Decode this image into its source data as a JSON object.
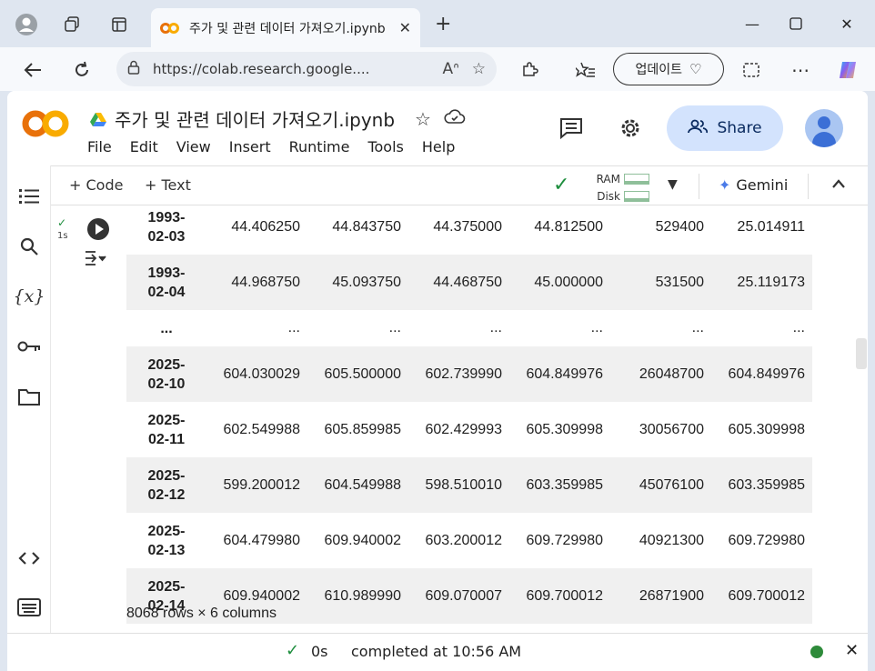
{
  "browser": {
    "tab_title": "주가 및 관련 데이터 가져오기.ipynb",
    "url": "https://colab.research.google....",
    "update_label": "업데이트"
  },
  "notebook": {
    "title": "주가 및 관련 데이터 가져오기.ipynb",
    "menu": [
      "File",
      "Edit",
      "View",
      "Insert",
      "Runtime",
      "Tools",
      "Help"
    ],
    "share_label": "Share"
  },
  "toolbar": {
    "code_label": "+ Code",
    "text_label": "+ Text",
    "ram_label": "RAM",
    "disk_label": "Disk",
    "gemini_label": "Gemini"
  },
  "cell": {
    "exec_time": "1s"
  },
  "dataframe": {
    "rows": [
      {
        "index": [
          "1993-",
          "02-03"
        ],
        "values": [
          "44.406250",
          "44.843750",
          "44.375000",
          "44.812500",
          "529400",
          "25.014911"
        ],
        "odd": false
      },
      {
        "index": [
          "1993-",
          "02-04"
        ],
        "values": [
          "44.968750",
          "45.093750",
          "44.468750",
          "45.000000",
          "531500",
          "25.119173"
        ],
        "odd": true
      },
      {
        "index": [
          "...",
          ""
        ],
        "values": [
          "...",
          "...",
          "...",
          "...",
          "...",
          "..."
        ],
        "odd": false,
        "ellipsis": true
      },
      {
        "index": [
          "2025-",
          "02-10"
        ],
        "values": [
          "604.030029",
          "605.500000",
          "602.739990",
          "604.849976",
          "26048700",
          "604.849976"
        ],
        "odd": true
      },
      {
        "index": [
          "2025-",
          "02-11"
        ],
        "values": [
          "602.549988",
          "605.859985",
          "602.429993",
          "605.309998",
          "30056700",
          "605.309998"
        ],
        "odd": false
      },
      {
        "index": [
          "2025-",
          "02-12"
        ],
        "values": [
          "599.200012",
          "604.549988",
          "598.510010",
          "603.359985",
          "45076100",
          "603.359985"
        ],
        "odd": true
      },
      {
        "index": [
          "2025-",
          "02-13"
        ],
        "values": [
          "604.479980",
          "609.940002",
          "603.200012",
          "609.729980",
          "40921300",
          "609.729980"
        ],
        "odd": false
      },
      {
        "index": [
          "2025-",
          "02-14"
        ],
        "values": [
          "609.940002",
          "610.989990",
          "609.070007",
          "609.700012",
          "26871900",
          "609.700012"
        ],
        "odd": true
      }
    ],
    "summary": "8068 rows × 6 columns"
  },
  "status": {
    "elapsed": "0s",
    "message": "completed at 10:56 AM"
  }
}
